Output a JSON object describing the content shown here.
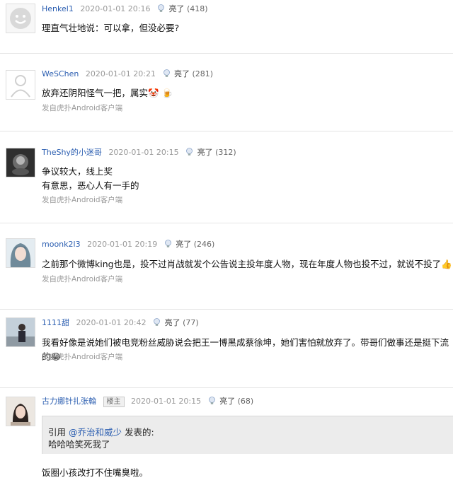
{
  "comments": [
    {
      "user": "Henkel1",
      "date": "2020-01-01 20:16",
      "light_label": "亮了",
      "light_count": "(418)",
      "content": [
        "理直气壮地说：可以拿，但没必要?"
      ],
      "source": "",
      "avatar_icon": "smiley-face-avatar-icon"
    },
    {
      "user": "WeSChen",
      "date": "2020-01-01 20:21",
      "light_label": "亮了",
      "light_count": "(281)",
      "content": [
        "放弃还阴阳怪气一把，属实🤡 🍺"
      ],
      "source": "发自虎扑Android客户端",
      "avatar_icon": "default-person-avatar-icon"
    },
    {
      "user": "TheShy的小迷哥",
      "date": "2020-01-01 20:15",
      "light_label": "亮了",
      "light_count": "(312)",
      "content": [
        "争议较大，线上奖",
        "有意思，恶心人有一手的"
      ],
      "source": "发自虎扑Android客户端",
      "avatar_icon": "dark-photo-avatar-icon"
    },
    {
      "user": "moonk2l3",
      "date": "2020-01-01 20:19",
      "light_label": "亮了",
      "light_count": "(246)",
      "content": [
        "之前那个微博king也是，投不过肖战就发个公告说主投年度人物，现在年度人物也投不过，就说不投了👍"
      ],
      "source": "发自虎扑Android客户端",
      "avatar_icon": "anime-girl-avatar-icon"
    },
    {
      "user": "1111甜",
      "date": "2020-01-01 20:42",
      "light_label": "亮了",
      "light_count": "(77)",
      "content": [
        "我看好像是说她们被电竞粉丝威胁说会把王一博黑成蔡徐坤，她们害怕就放弃了。带哥们做事还是挺下流的😂"
      ],
      "source": "发自虎扑Android客户端",
      "avatar_icon": "person-photo-avatar-icon"
    },
    {
      "user": "古力娜针扎张翰",
      "badge": "楼主",
      "date": "2020-01-01 20:15",
      "light_label": "亮了",
      "light_count": "(68)",
      "quote": {
        "prefix": "引用 ",
        "target": "@乔治和威少",
        "suffix": " 发表的:",
        "text": "哈哈哈笑死我了"
      },
      "content": [
        "饭圈小孩改打不住嘴臭啦。"
      ],
      "source": "",
      "avatar_icon": "portrait-photo-avatar-icon"
    }
  ],
  "colors": {
    "username": "#2a5db0",
    "meta": "#999999",
    "quote_bg": "#ececec"
  }
}
